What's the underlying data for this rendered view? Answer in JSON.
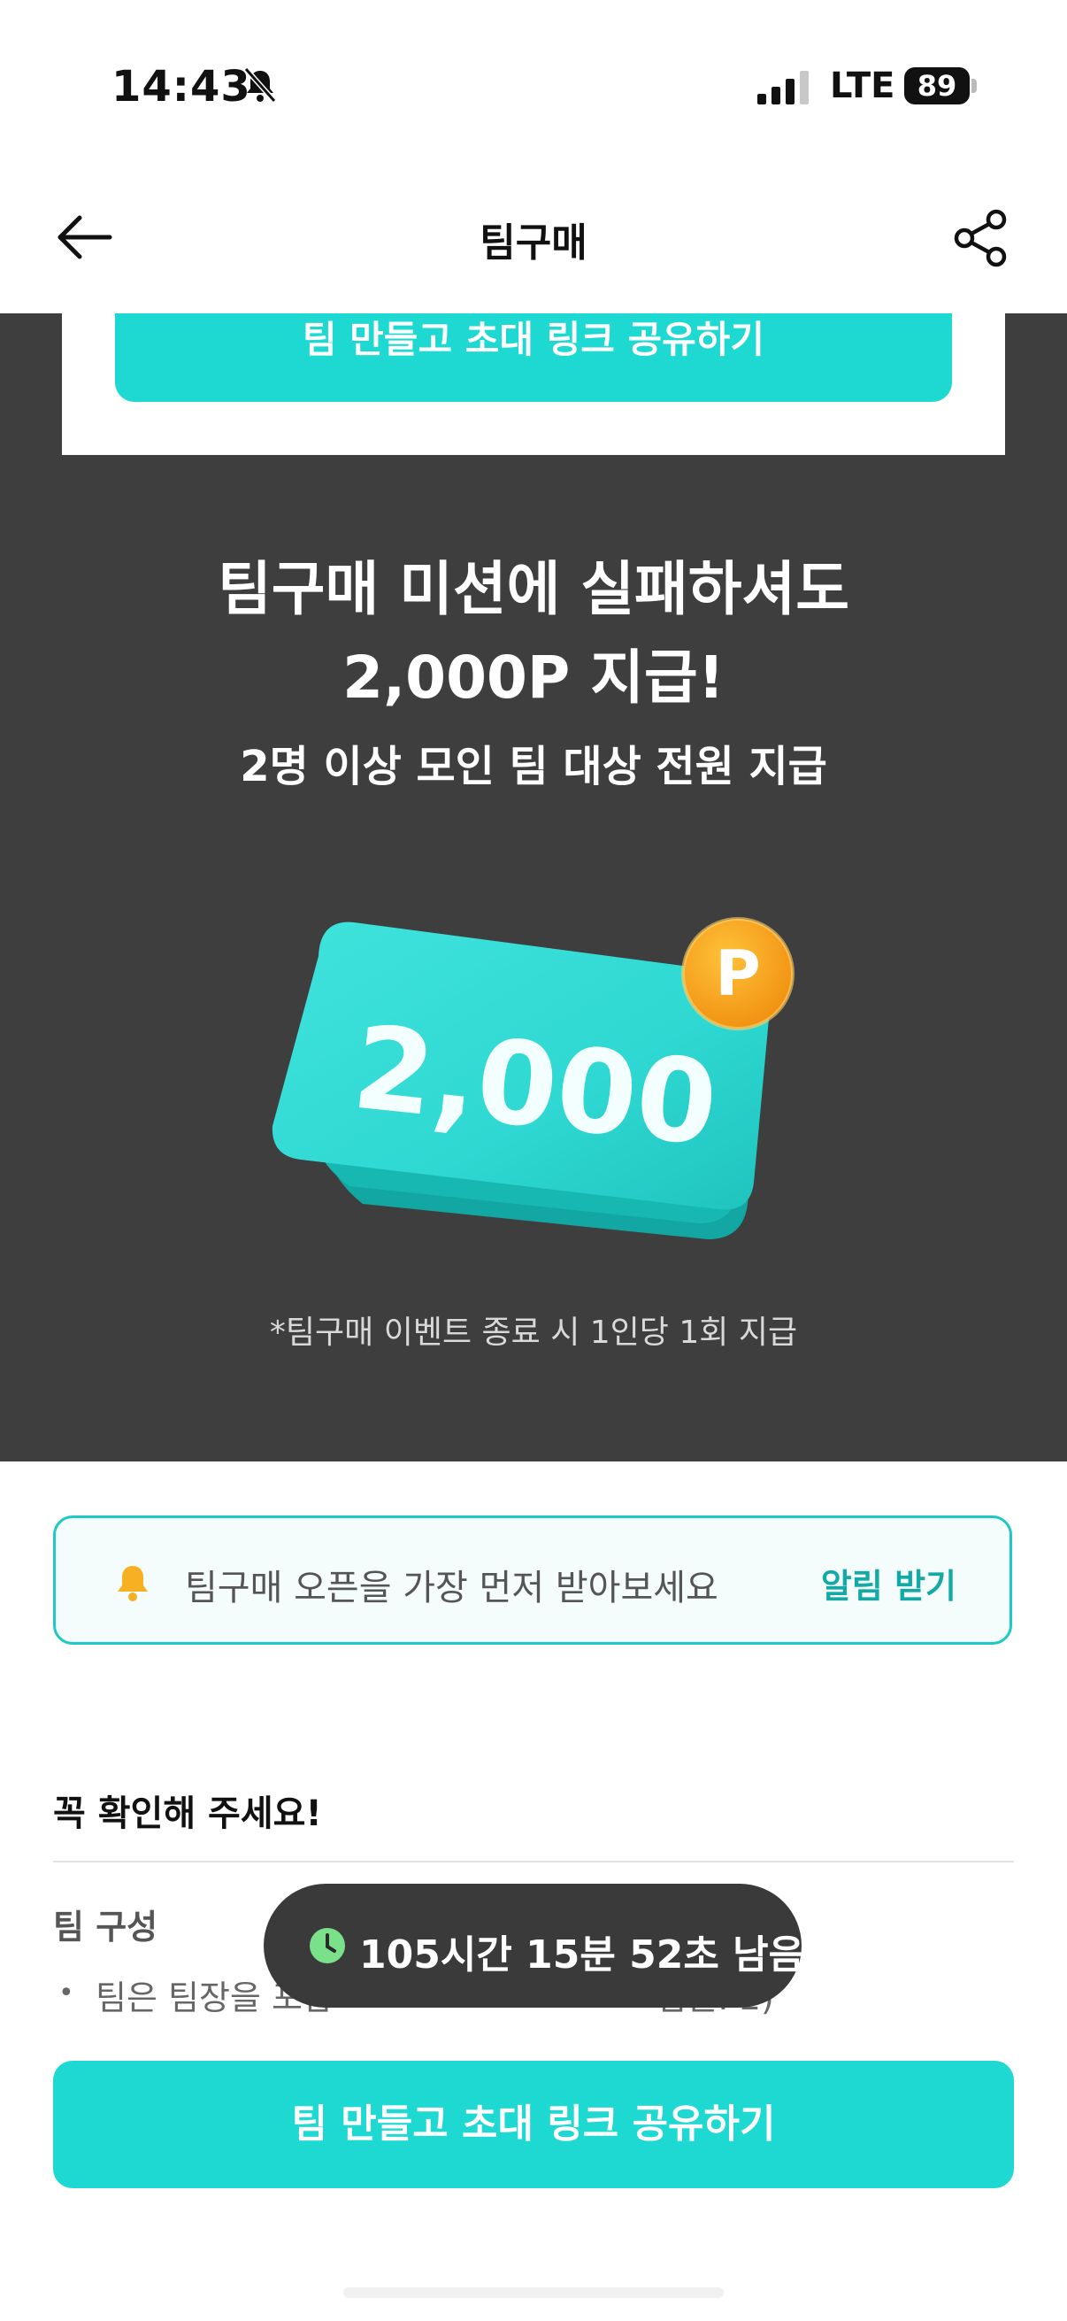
{
  "status_bar": {
    "time": "14:43",
    "network": "LTE",
    "battery": "89"
  },
  "nav": {
    "title": "팀구매"
  },
  "top_cta": {
    "label": "팀 만들고 초대 링크 공유하기"
  },
  "promo": {
    "line1": "팀구매 미션에 실패하셔도",
    "line2": "2,000P 지급!",
    "sub": "2명 이상 모인 팀 대상 전원 지급",
    "amount": "2,000",
    "badge": "P",
    "note": "*팀구매 이벤트 종료 시 1인당 1회 지급"
  },
  "notify": {
    "text": "팀구매 오픈을 가장 먼저 받아보세요",
    "action": "알림 받기"
  },
  "info": {
    "title": "꼭 확인해 주세요!",
    "team_heading": "팀 구성",
    "team_rule": "팀은 팀장을 포함",
    "team_rule_tail": "팀원: 2)"
  },
  "countdown": {
    "text": "105시간 15분 52초 남음"
  },
  "bottom_cta": {
    "label": "팀 만들고 초대 링크 공유하기"
  },
  "colors": {
    "accent": "#1ed8d2",
    "dark_bg": "#3e3e3e",
    "coin": "#f7a21b",
    "clock_green": "#7be08a"
  }
}
